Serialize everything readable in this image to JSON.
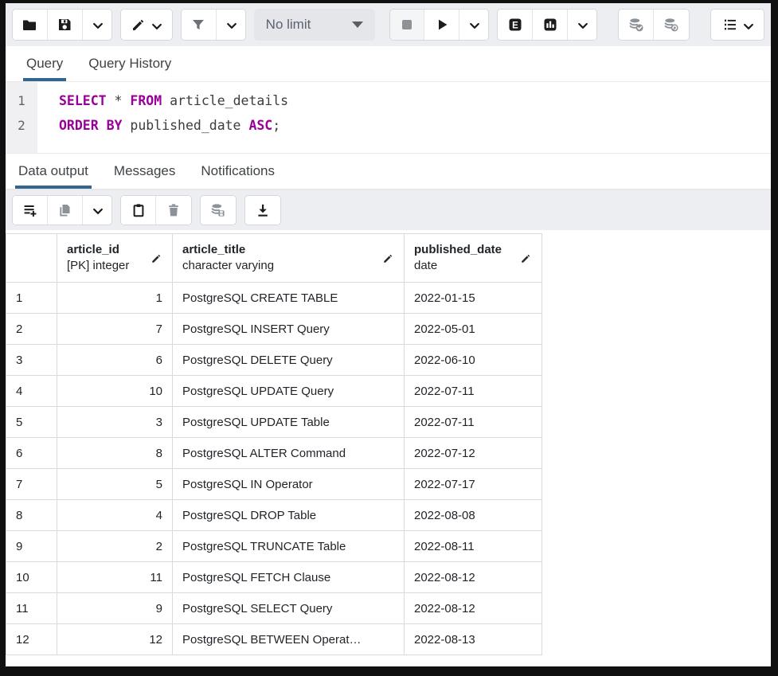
{
  "colors": {
    "accent_blue": "#326690",
    "sql_keyword": "#990099",
    "toolbar_bg": "#eceef2",
    "frame_border": "#101010",
    "grid_border": "#d8dade",
    "icon_dark": "#1c1c1e",
    "icon_disabled": "#8d9298"
  },
  "toolbar_top": {
    "limit_label": "No limit",
    "icons": [
      "open-file",
      "save",
      "save-menu",
      "edit",
      "filter",
      "filter-menu",
      "stop",
      "execute",
      "execute-menu",
      "explain",
      "explain-analyze",
      "explain-menu",
      "commit",
      "rollback",
      "macros-menu"
    ]
  },
  "query_tabs": {
    "query": "Query",
    "history": "Query History"
  },
  "sql": {
    "lines": [
      {
        "no": "1",
        "tokens": [
          {
            "c": "k",
            "t": "SELECT"
          },
          {
            "c": "p",
            "t": " * "
          },
          {
            "c": "k",
            "t": "FROM"
          },
          {
            "c": "p",
            "t": " article_details"
          }
        ]
      },
      {
        "no": "2",
        "tokens": [
          {
            "c": "k",
            "t": "ORDER BY"
          },
          {
            "c": "p",
            "t": " published_date "
          },
          {
            "c": "k",
            "t": "ASC"
          },
          {
            "c": "p",
            "t": ";"
          }
        ]
      }
    ]
  },
  "output_tabs": {
    "data_output": "Data output",
    "messages": "Messages",
    "notifications": "Notifications"
  },
  "toolbar_output": {
    "icons": [
      "add-row",
      "copy",
      "copy-menu",
      "paste",
      "delete",
      "save-data-changes",
      "save-results-to-file"
    ]
  },
  "grid": {
    "columns": [
      {
        "name": "article_id",
        "type": "[PK] integer"
      },
      {
        "name": "article_title",
        "type": "character varying"
      },
      {
        "name": "published_date",
        "type": "date"
      }
    ],
    "rows": [
      {
        "n": "1",
        "id": "1",
        "title": "PostgreSQL CREATE TABLE",
        "date": "2022-01-15"
      },
      {
        "n": "2",
        "id": "7",
        "title": "PostgreSQL INSERT Query",
        "date": "2022-05-01"
      },
      {
        "n": "3",
        "id": "6",
        "title": "PostgreSQL DELETE Query",
        "date": "2022-06-10"
      },
      {
        "n": "4",
        "id": "10",
        "title": "PostgreSQL UPDATE Query",
        "date": "2022-07-11"
      },
      {
        "n": "5",
        "id": "3",
        "title": "PostgreSQL UPDATE Table",
        "date": "2022-07-11"
      },
      {
        "n": "6",
        "id": "8",
        "title": "PostgreSQL ALTER Command",
        "date": "2022-07-12"
      },
      {
        "n": "7",
        "id": "5",
        "title": "PostgreSQL IN Operator",
        "date": "2022-07-17"
      },
      {
        "n": "8",
        "id": "4",
        "title": "PostgreSQL DROP Table",
        "date": "2022-08-08"
      },
      {
        "n": "9",
        "id": "2",
        "title": "PostgreSQL TRUNCATE Table",
        "date": "2022-08-11"
      },
      {
        "n": "10",
        "id": "11",
        "title": "PostgreSQL FETCH Clause",
        "date": "2022-08-12"
      },
      {
        "n": "11",
        "id": "9",
        "title": "PostgreSQL SELECT Query",
        "date": "2022-08-12"
      },
      {
        "n": "12",
        "id": "12",
        "title": "PostgreSQL BETWEEN Operat…",
        "date": "2022-08-13"
      }
    ]
  }
}
